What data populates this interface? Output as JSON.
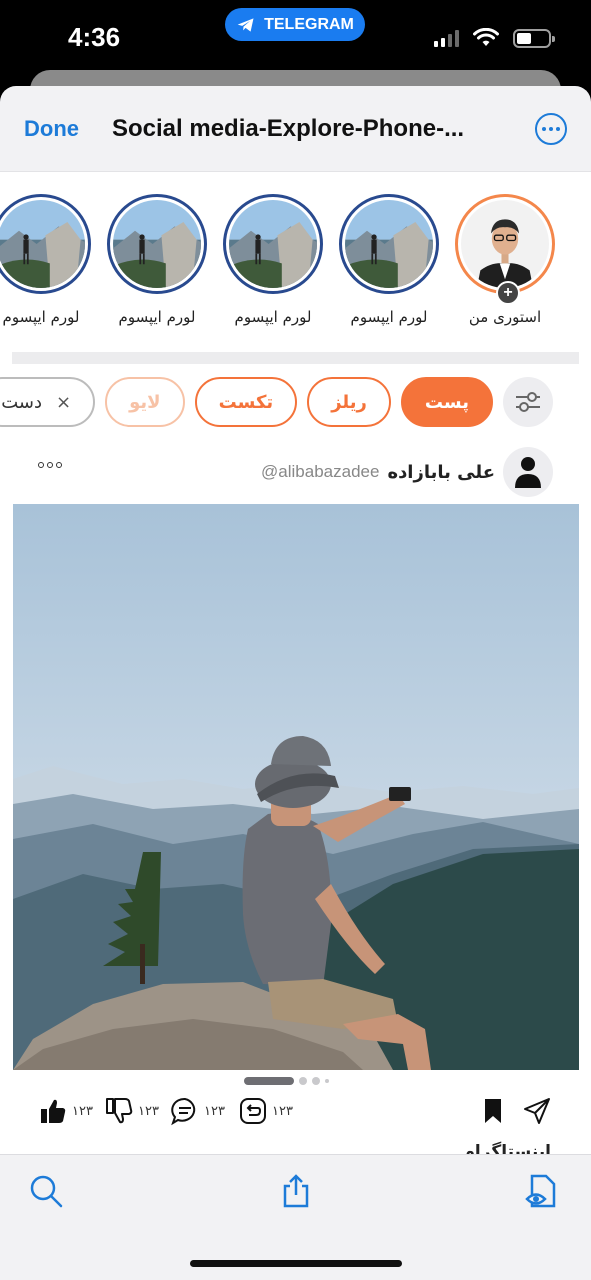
{
  "status": {
    "time": "4:36",
    "pill_label": "TELEGRAM"
  },
  "nav": {
    "done_label": "Done",
    "title": "Social media-Explore-Phone-..."
  },
  "stories": [
    {
      "label": "استوری من",
      "type": "mine"
    },
    {
      "label": "لورم ایپسوم",
      "type": "landscape"
    },
    {
      "label": "لورم ایپسوم",
      "type": "landscape"
    },
    {
      "label": "لورم ایپسوم",
      "type": "landscape"
    },
    {
      "label": "لورم ایپسوم",
      "type": "landscape"
    }
  ],
  "chips": {
    "post": "پست",
    "reels": "ریلز",
    "text": "تکست",
    "live": "لایو",
    "category": "دست"
  },
  "post": {
    "author_name": "علی بابازاده",
    "author_handle": "@alibabazadee",
    "likes": "۱۲۳",
    "dislikes": "۱۲۳",
    "comments": "۱۲۳",
    "reposts": "۱۲۳",
    "next_text": "اینستاگرام"
  },
  "colors": {
    "accent": "#f4733a",
    "ios_blue": "#1d7bd8",
    "story_ring": "#294a8f"
  }
}
